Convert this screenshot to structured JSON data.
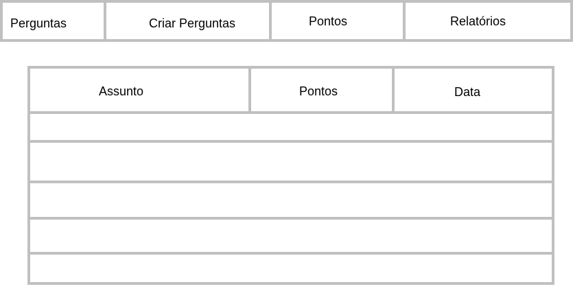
{
  "nav": {
    "tabs": [
      {
        "label": "Perguntas"
      },
      {
        "label": "Criar Perguntas"
      },
      {
        "label": "Pontos"
      },
      {
        "label": "Relatórios"
      }
    ]
  },
  "table": {
    "columns": [
      "Assunto",
      "Pontos",
      "Data"
    ],
    "rows": [
      [
        "",
        "",
        ""
      ],
      [
        "",
        "",
        ""
      ],
      [
        "",
        "",
        ""
      ],
      [
        "",
        "",
        ""
      ],
      [
        "",
        "",
        ""
      ]
    ]
  },
  "colors": {
    "border": "#c0c0c0",
    "background": "#ffffff",
    "text": "#000000"
  }
}
